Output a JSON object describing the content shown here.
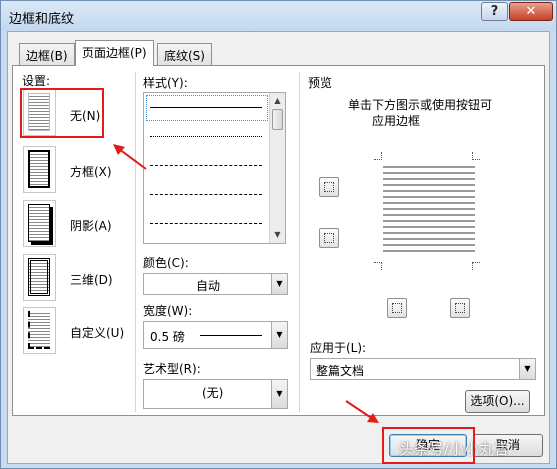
{
  "window": {
    "title": "边框和底纹",
    "help_glyph": "?",
    "close_glyph": "✕"
  },
  "tabs": [
    {
      "label": "边框(B)",
      "active": false
    },
    {
      "label": "页面边框(P)",
      "active": true
    },
    {
      "label": "底纹(S)",
      "active": false
    }
  ],
  "settings": {
    "heading": "设置:",
    "items": [
      {
        "label": "无(N)",
        "selected": true
      },
      {
        "label": "方框(X)"
      },
      {
        "label": "阴影(A)"
      },
      {
        "label": "三维(D)"
      },
      {
        "label": "自定义(U)"
      }
    ]
  },
  "style": {
    "heading": "样式(Y):",
    "scroll_up": "▲",
    "scroll_down": "▼"
  },
  "color": {
    "label": "颜色(C):",
    "value": "自动"
  },
  "width": {
    "label": "宽度(W):",
    "value": "0.5 磅"
  },
  "art": {
    "label": "艺术型(R):",
    "value": "(无)"
  },
  "preview": {
    "heading": "预览",
    "hint_line1": "单击下方图示或使用按钮可",
    "hint_line2": "应用边框"
  },
  "apply": {
    "label": "应用于(L):",
    "value": "整篇文档"
  },
  "buttons": {
    "options": "选项(O)...",
    "ok": "确定",
    "cancel": "取消"
  },
  "dropdown_glyph": "▼",
  "watermark": "头条号/小小丸言",
  "colors": {
    "highlight": "#e21b1b",
    "title_bar": "#c9dcef"
  }
}
